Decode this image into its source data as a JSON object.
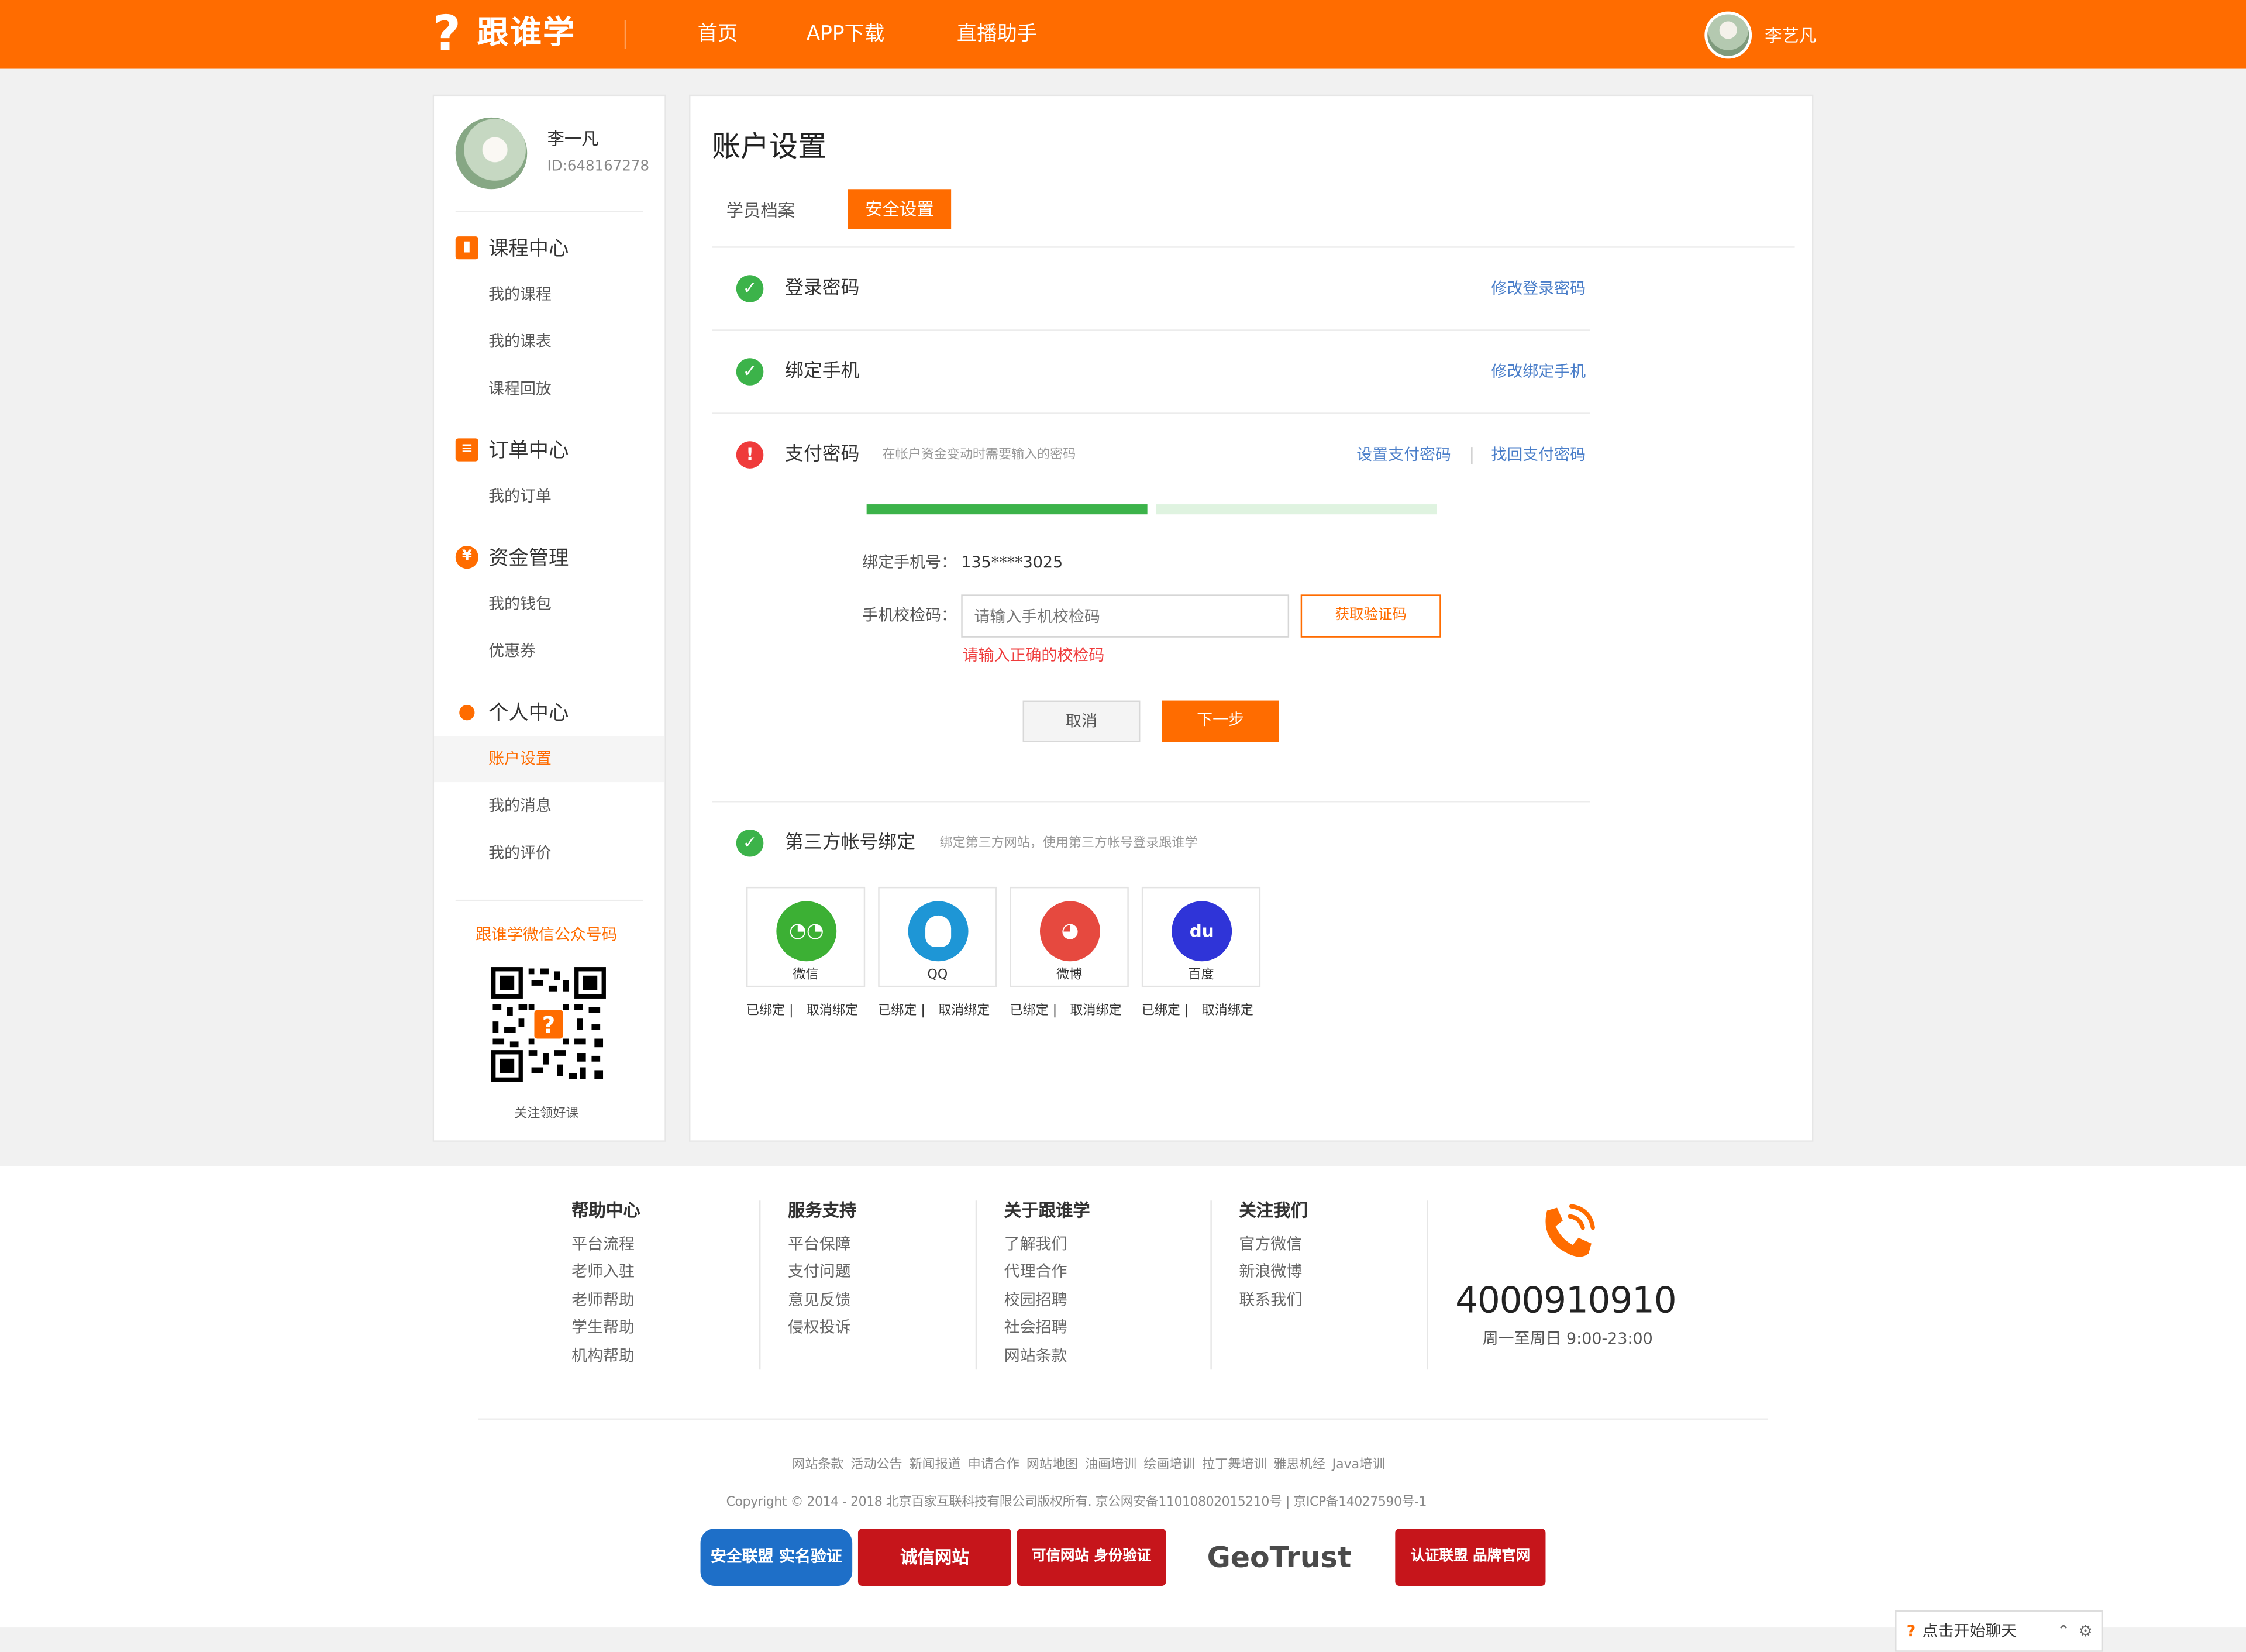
{
  "header": {
    "logo_mark": "?",
    "logo_text": "跟谁学",
    "nav": [
      "首页",
      "APP下载",
      "直播助手"
    ],
    "user_name": "李艺凡"
  },
  "sidebar": {
    "user_name": "李一凡",
    "user_id": "ID:648167278",
    "sections": [
      {
        "title": "课程中心",
        "icon": "book-icon",
        "items": [
          "我的课程",
          "我的课表",
          "课程回放"
        ]
      },
      {
        "title": "订单中心",
        "icon": "order-icon",
        "items": [
          "我的订单"
        ]
      },
      {
        "title": "资金管理",
        "icon": "money-icon",
        "items": [
          "我的钱包",
          "优惠券"
        ]
      },
      {
        "title": "个人中心",
        "icon": "person-icon",
        "items": [
          "账户设置",
          "我的消息",
          "我的评价"
        ]
      }
    ],
    "active_item": "账户设置",
    "qr_title": "跟谁学微信公众号码",
    "qr_caption": "关注领好课"
  },
  "main": {
    "title": "账户设置",
    "tabs": [
      "学员档案",
      "安全设置"
    ],
    "active_tab": "安全设置",
    "rows": [
      {
        "label": "登录密码",
        "status": "ok",
        "actions": [
          "修改登录密码"
        ]
      },
      {
        "label": "绑定手机",
        "status": "ok",
        "actions": [
          "修改绑定手机"
        ]
      },
      {
        "label": "支付密码",
        "status": "warn",
        "hint": "在帐户资金变动时需要输入的密码",
        "actions": [
          "设置支付密码",
          "找回支付密码"
        ]
      }
    ],
    "progress": {
      "step": 1,
      "steps": 2
    },
    "form": {
      "phone_label": "绑定手机号：",
      "phone_value": "135****3025",
      "code_label": "手机校检码：",
      "code_placeholder": "请输入手机校检码",
      "get_code": "获取验证码",
      "error": "请输入正确的校检码",
      "cancel": "取消",
      "next": "下一步"
    },
    "third_party": {
      "label": "第三方帐号绑定",
      "hint": "绑定第三方网站，使用第三方帐号登录跟谁学",
      "accounts": [
        {
          "name": "微信",
          "icon": "wechat-icon",
          "color": "#3cb034"
        },
        {
          "name": "QQ",
          "icon": "qq-icon",
          "color": "#1e96d6"
        },
        {
          "name": "微博",
          "icon": "weibo-icon",
          "color": "#e6493f"
        },
        {
          "name": "百度",
          "icon": "baidu-icon",
          "color": "#2f34d8"
        }
      ],
      "bound_text": "已绑定",
      "unbind_text": "取消绑定"
    }
  },
  "footer": {
    "columns": [
      {
        "title": "帮助中心",
        "items": [
          "平台流程",
          "老师入驻",
          "老师帮助",
          "学生帮助",
          "机构帮助"
        ]
      },
      {
        "title": "服务支持",
        "items": [
          "平台保障",
          "支付问题",
          "意见反馈",
          "侵权投诉"
        ]
      },
      {
        "title": "关于跟谁学",
        "items": [
          "了解我们",
          "代理合作",
          "校园招聘",
          "社会招聘",
          "网站条款"
        ]
      },
      {
        "title": "关注我们",
        "items": [
          "官方微信",
          "新浪微博",
          "联系我们"
        ]
      }
    ],
    "phone": "4000910910",
    "hours": "周一至周日 9:00-23:00",
    "links": [
      "网站条款",
      "活动公告",
      "新闻报道",
      "申请合作",
      "网站地图",
      "油画培训",
      "绘画培训",
      "拉丁舞培训",
      "雅思机经",
      "Java培训"
    ],
    "copyright": "Copyright © 2014 - 2018 北京百家互联科技有限公司版权所有. 京公网安备11010802015210号 | 京ICP备14027590号-1",
    "badges": [
      {
        "text": "安全联盟 实名验证",
        "color": "#1e6fc8"
      },
      {
        "text": "诚信网站",
        "color": "#c6151b"
      },
      {
        "text": "可信网站 身份验证",
        "color": "#c6151b"
      },
      {
        "text": "GeoTrust",
        "color": "#4a4a4a"
      },
      {
        "text": "认证联盟 品牌官网",
        "color": "#c6151b"
      }
    ]
  },
  "chat_widget": {
    "label": "点击开始聊天"
  },
  "colors": {
    "brand": "#ff6c00",
    "success": "#3cb34a",
    "error": "#ef3b3b",
    "link": "#4a7ec9"
  }
}
